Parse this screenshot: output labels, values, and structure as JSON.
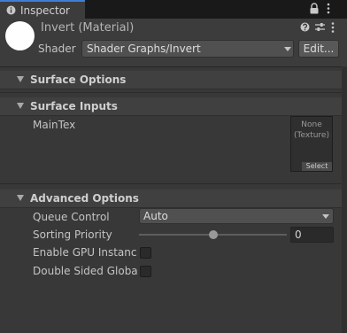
{
  "tab": {
    "label": "Inspector"
  },
  "header": {
    "title": "Invert (Material)",
    "shader_label": "Shader",
    "shader_value": "Shader Graphs/Invert",
    "edit_label": "Edit..."
  },
  "sections": {
    "surface_options": "Surface Options",
    "surface_inputs": "Surface Inputs",
    "advanced_options": "Advanced Options"
  },
  "surface_inputs": {
    "maintex_label": "MainTex",
    "texture_none_line1": "None",
    "texture_none_line2": "(Texture)",
    "select_label": "Select"
  },
  "advanced": {
    "queue_control_label": "Queue Control",
    "queue_control_value": "Auto",
    "sorting_priority_label": "Sorting Priority",
    "sorting_priority_value": "0",
    "sorting_priority_slider_fraction": 0.5,
    "gpu_instancing_label": "Enable GPU Instancin",
    "gpu_instancing_checked": false,
    "double_sided_label": "Double Sided Global",
    "double_sided_checked": false
  },
  "icons": {
    "tab": "info-icon",
    "lock": "lock-icon",
    "menu": "kebab-menu-icon",
    "help": "help-icon",
    "preset": "preset-icon",
    "material_preview": "material-sphere-icon"
  },
  "colors": {
    "accent": "#3d7fd6",
    "background": "#383838",
    "header_background": "#3c3c3c"
  }
}
